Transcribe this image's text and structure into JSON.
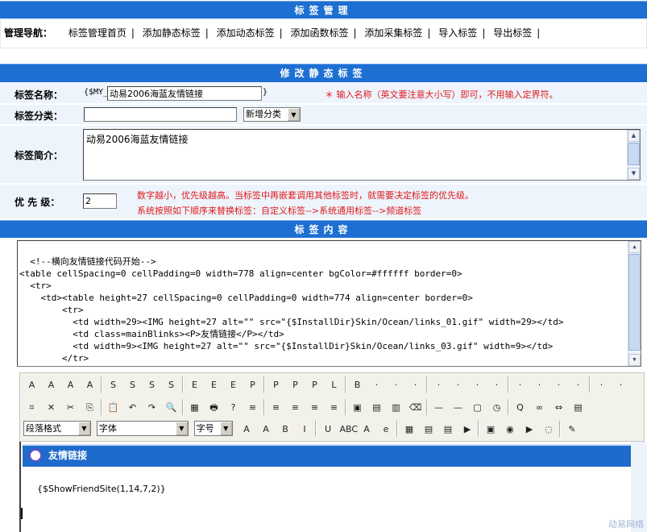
{
  "header": {
    "title": "标签管理"
  },
  "nav": {
    "title": "管理导航：",
    "links": [
      "标签管理首页",
      "添加静态标签",
      "添加动态标签",
      "添加函数标签",
      "添加采集标签",
      "导入标签",
      "导出标签"
    ],
    "sep": "|"
  },
  "form": {
    "section_title": "修改静态标签",
    "name_label": "标签名称：",
    "name_prefix": "{$MY_",
    "name_value": "动易2006海蓝友情链接",
    "name_suffix": "}",
    "name_hint": "＊ 输入名称（英文要注意大小写）即可，不用输入定界符。",
    "category_label": "标签分类：",
    "category_value": "",
    "category_select": "新增分类",
    "intro_label": "标签简介：",
    "intro_value": "动易2006海蓝友情链接",
    "priority_label": "优 先 级：",
    "priority_value": "2",
    "priority_hint_1": "数字越小，优先级越高。当标签中再嵌套调用其他标签时，就需要决定标签的优先级。",
    "priority_hint_2": "系统按照如下顺序来替换标签：自定义标签-->系统通用标签-->频道标签"
  },
  "content": {
    "section_title": "标签内容",
    "code": "<!--横向友情链接代码开始-->\n<table cellSpacing=0 cellPadding=0 width=778 align=center bgColor=#ffffff border=0>\n  <tr>\n    <td><table height=27 cellSpacing=0 cellPadding=0 width=774 align=center border=0>\n        <tr>\n          <td width=29><IMG height=27 alt=\"\" src=\"{$InstallDir}Skin/Ocean/links_01.gif\" width=29></td>\n          <td class=mainBlinks><P>友情链接</P></td>\n          <td width=9><IMG height=27 alt=\"\" src=\"{$InstallDir}Skin/Ocean/links_03.gif\" width=9></td>\n        </tr>\n      </table></td>"
  },
  "toolbar": {
    "row1": [
      "A",
      "A",
      "A",
      "A",
      "S",
      "S",
      "S",
      "S",
      "E",
      "E",
      "E",
      "P",
      "P",
      "P",
      "P",
      "L",
      "B",
      "·",
      "·",
      "·",
      "·",
      "·",
      "·",
      "·",
      "·",
      "·",
      "·",
      "·",
      "·",
      "·"
    ],
    "row2": [
      "⌗",
      "✕",
      "✂",
      "⎘",
      "📋",
      "↶",
      "↷",
      "🔍",
      "▦",
      "🖶",
      "?",
      "≡",
      "≡",
      "≡",
      "≡",
      "≡",
      "▣",
      "▤",
      "▥",
      "⌫",
      "—",
      "—",
      "▢",
      "◷",
      "Q",
      "∞",
      "⇔",
      "▤"
    ],
    "paragraph_select": "段落格式",
    "font_select": "字体",
    "size_select": "字号",
    "row3": [
      "A",
      "A",
      "B",
      "I",
      "U",
      "ABC",
      "A",
      "e",
      "▦",
      "▤",
      "▤",
      "▶",
      "▣",
      "◉",
      "▶",
      "◌",
      "✎"
    ]
  },
  "editor": {
    "header_title": "友情链接",
    "tag_text": "{$ShowFriendSite(1,14,7,2)}"
  },
  "footer": {
    "logo_text": "动易网络"
  },
  "colors": {
    "header_blue": "#1e6fd2",
    "row_bg": "#edf4fc",
    "hint_red": "#e0181b"
  }
}
